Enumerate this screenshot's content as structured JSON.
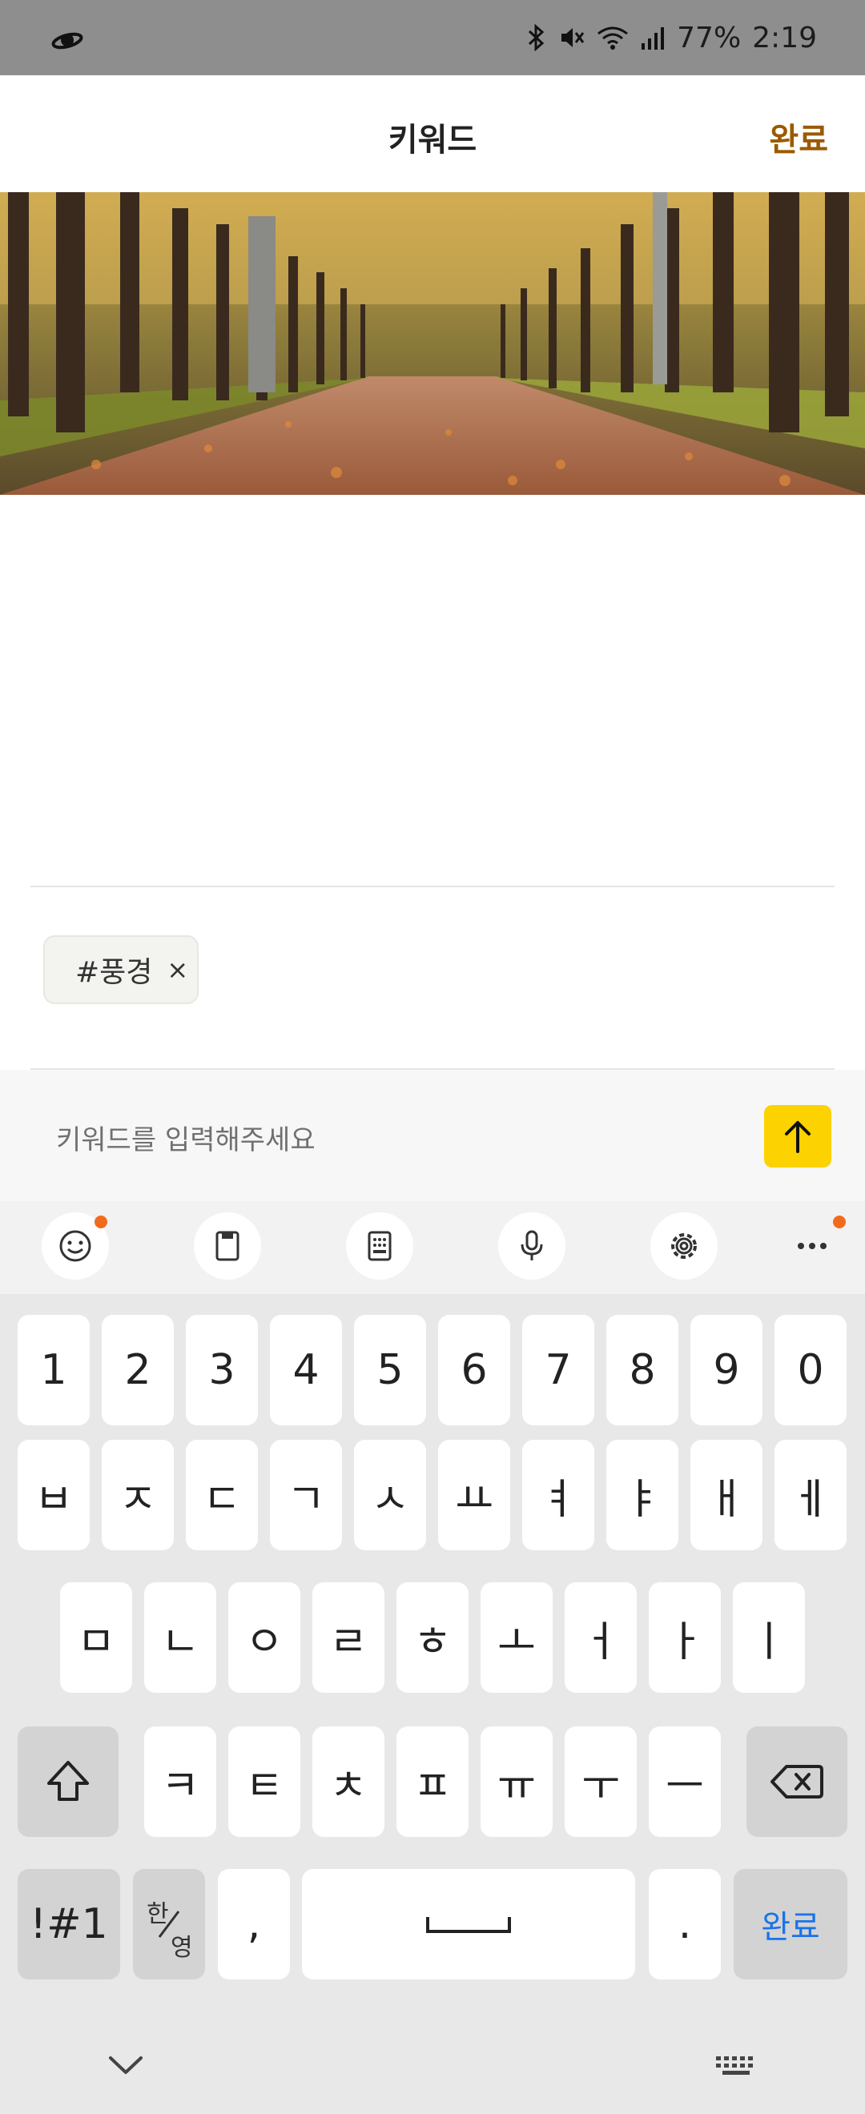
{
  "status": {
    "battery": "77%",
    "time": "2:19"
  },
  "header": {
    "title": "키워드",
    "done_label": "완료"
  },
  "photo": {
    "alt": "autumn tree-lined path"
  },
  "keywords": [
    {
      "label": "#풍경",
      "remove": "×"
    }
  ],
  "input": {
    "placeholder": "키워드를 입력해주세요"
  },
  "keyboard": {
    "numbers": [
      "1",
      "2",
      "3",
      "4",
      "5",
      "6",
      "7",
      "8",
      "9",
      "0"
    ],
    "row1": [
      "ㅂ",
      "ㅈ",
      "ㄷ",
      "ㄱ",
      "ㅅ",
      "ㅛ",
      "ㅕ",
      "ㅑ",
      "ㅐ",
      "ㅔ"
    ],
    "row2": [
      "ㅁ",
      "ㄴ",
      "ㅇ",
      "ㄹ",
      "ㅎ",
      "ㅗ",
      "ㅓ",
      "ㅏ",
      "ㅣ"
    ],
    "row3": [
      "ㅋ",
      "ㅌ",
      "ㅊ",
      "ㅍ",
      "ㅠ",
      "ㅜ",
      "ㅡ"
    ],
    "symbols": "!#1",
    "lang_top": "한",
    "lang_bottom": "영",
    "comma": ",",
    "period": ".",
    "enter": "완료"
  }
}
